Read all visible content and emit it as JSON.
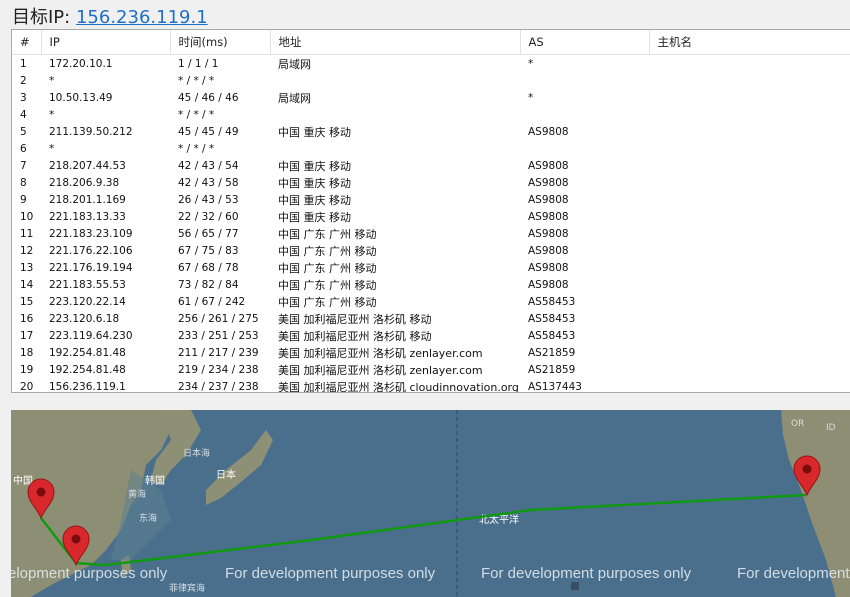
{
  "header": {
    "label": "目标IP:",
    "ip": "156.236.119.1"
  },
  "table": {
    "columns": [
      "#",
      "IP",
      "时间(ms)",
      "地址",
      "AS",
      "主机名"
    ],
    "rows": [
      [
        "1",
        "172.20.10.1",
        "1 / 1 / 1",
        "局域网",
        "*",
        ""
      ],
      [
        "2",
        "*",
        "* / * / *",
        "",
        "",
        ""
      ],
      [
        "3",
        "10.50.13.49",
        "45 / 46 / 46",
        "局域网",
        "*",
        ""
      ],
      [
        "4",
        "*",
        "* / * / *",
        "",
        "",
        ""
      ],
      [
        "5",
        "211.139.50.212",
        "45 / 45 / 49",
        "中国 重庆 移动",
        "AS9808",
        ""
      ],
      [
        "6",
        "*",
        "* / * / *",
        "",
        "",
        ""
      ],
      [
        "7",
        "218.207.44.53",
        "42 / 43 / 54",
        "中国 重庆 移动",
        "AS9808",
        ""
      ],
      [
        "8",
        "218.206.9.38",
        "42 / 43 / 58",
        "中国 重庆 移动",
        "AS9808",
        ""
      ],
      [
        "9",
        "218.201.1.169",
        "26 / 43 / 53",
        "中国 重庆 移动",
        "AS9808",
        ""
      ],
      [
        "10",
        "221.183.13.33",
        "22 / 32 / 60",
        "中国 重庆 移动",
        "AS9808",
        ""
      ],
      [
        "11",
        "221.183.23.109",
        "56 / 65 / 77",
        "中国 广东 广州 移动",
        "AS9808",
        ""
      ],
      [
        "12",
        "221.176.22.106",
        "67 / 75 / 83",
        "中国 广东 广州 移动",
        "AS9808",
        ""
      ],
      [
        "13",
        "221.176.19.194",
        "67 / 68 / 78",
        "中国 广东 广州 移动",
        "AS9808",
        ""
      ],
      [
        "14",
        "221.183.55.53",
        "73 / 82 / 84",
        "中国 广东 广州 移动",
        "AS9808",
        ""
      ],
      [
        "15",
        "223.120.22.14",
        "61 / 67 / 242",
        "中国 广东 广州 移动",
        "AS58453",
        ""
      ],
      [
        "16",
        "223.120.6.18",
        "256 / 261 / 275",
        "美国 加利福尼亚州 洛杉矶 移动",
        "AS58453",
        ""
      ],
      [
        "17",
        "223.119.64.230",
        "233 / 251 / 253",
        "美国 加利福尼亚州 洛杉矶 移动",
        "AS58453",
        ""
      ],
      [
        "18",
        "192.254.81.48",
        "211 / 217 / 239",
        "美国 加利福尼亚州 洛杉矶 zenlayer.com",
        "AS21859",
        ""
      ],
      [
        "19",
        "192.254.81.48",
        "219 / 234 / 238",
        "美国 加利福尼亚州 洛杉矶 zenlayer.com",
        "AS21859",
        ""
      ],
      [
        "20",
        "156.236.119.1",
        "234 / 237 / 238",
        "美国 加利福尼亚州 洛杉矶 cloudinnovation.org",
        "AS137443",
        ""
      ]
    ]
  },
  "map": {
    "watermark": "For development purposes only",
    "watermark_partial_left": "elopment purposes only",
    "watermark_partial_right": "For development",
    "labels": {
      "china": "中国",
      "korea": "韩国",
      "japan": "日本",
      "sea_of_japan": "日本海",
      "yellow_sea": "黄海",
      "east_sea": "东海",
      "philippine_sea": "菲律宾海",
      "north_pacific": "北太平洋",
      "oregon": "OR",
      "idaho": "ID"
    },
    "route_color": "#119a11",
    "marker_color": "#d9282b",
    "ocean_color": "#4a6f8c"
  }
}
